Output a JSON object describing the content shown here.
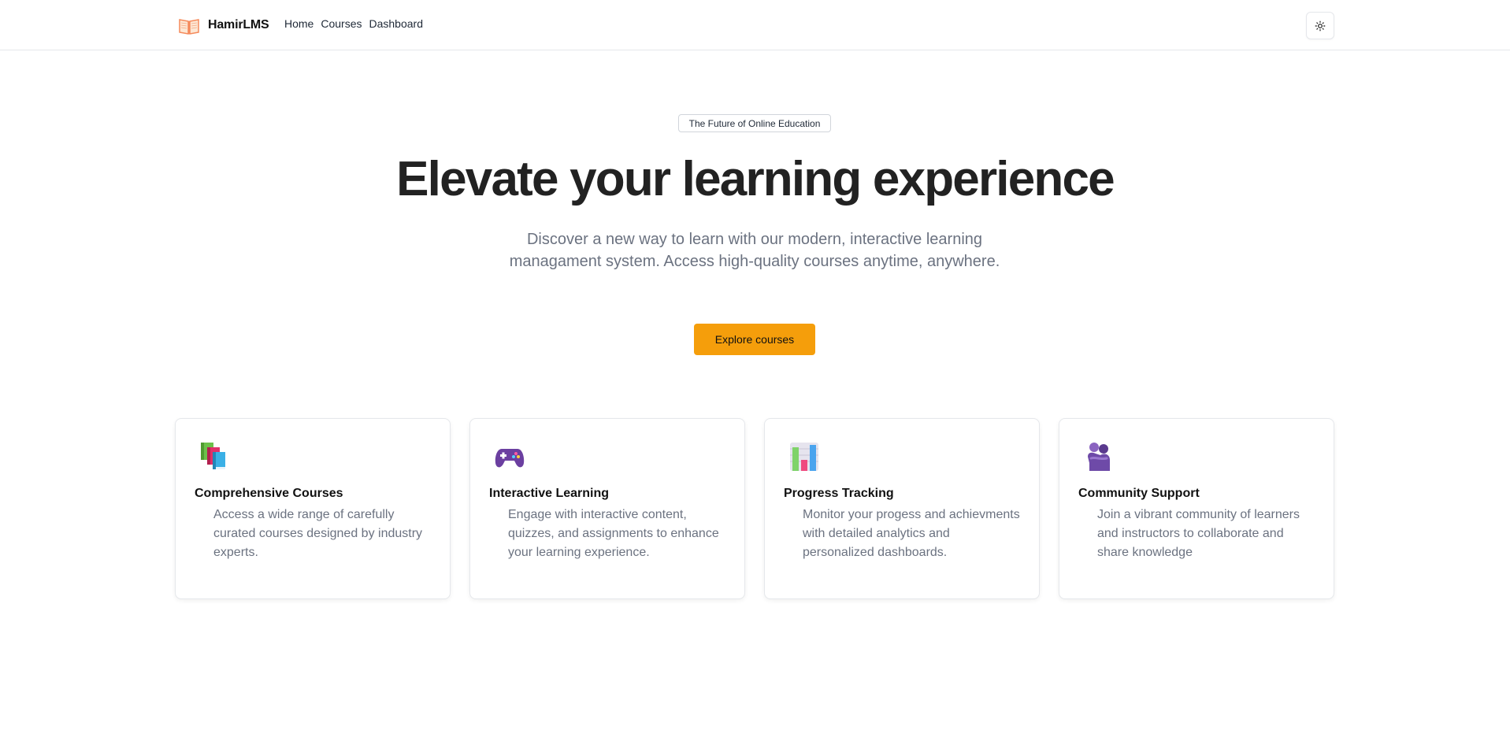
{
  "header": {
    "brand_name": "HamirLMS",
    "brand_icon": "open-book-icon",
    "nav": [
      {
        "label": "Home"
      },
      {
        "label": "Courses"
      },
      {
        "label": "Dashboard"
      }
    ],
    "theme_toggle_icon": "sun-icon"
  },
  "hero": {
    "badge": "The Future of Online Education",
    "headline": "Elevate your learning experience",
    "subtext": "Discover a new way to learn with our modern, interactive learning managament system. Access high-quality courses anytime, anywhere.",
    "cta_label": "Explore courses"
  },
  "features": [
    {
      "icon": "books-icon",
      "title": "Comprehensive Courses",
      "description": "Access a wide range of carefully curated courses designed by industry experts."
    },
    {
      "icon": "game-controller-icon",
      "title": "Interactive Learning",
      "description": "Engage with interactive content, quizzes, and assignments to enhance your learning experience."
    },
    {
      "icon": "bar-chart-icon",
      "title": "Progress Tracking",
      "description": "Monitor your progess and achievments with detailed analytics and personalized dashboards."
    },
    {
      "icon": "people-hugging-icon",
      "title": "Community Support",
      "description": "Join a vibrant community of learners and instructors to collaborate and share knowledge"
    }
  ],
  "colors": {
    "accent": "#f59e0b",
    "text_muted": "#6b7280",
    "border": "#e5e7eb"
  }
}
